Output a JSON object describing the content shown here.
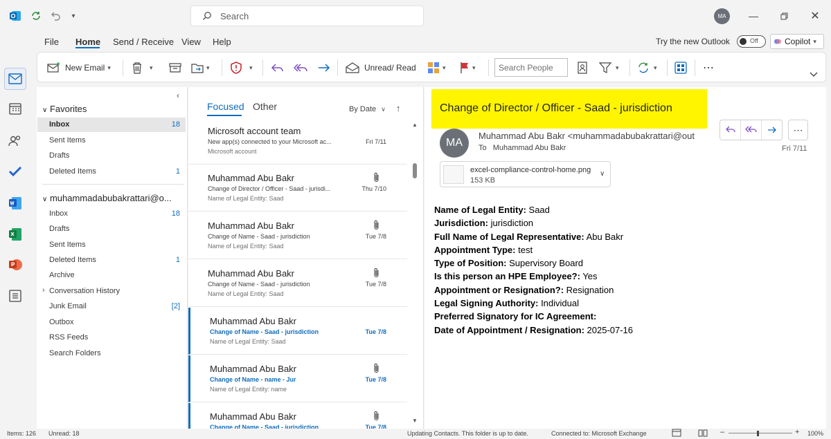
{
  "titlebar": {
    "search_placeholder": "Search",
    "avatar_initials": "MA"
  },
  "menu": {
    "tabs": [
      "File",
      "Home",
      "Send / Receive",
      "View",
      "Help"
    ],
    "try_new_outlook": "Try the new Outlook",
    "toggle_label": "Off",
    "copilot_label": "Copilot"
  },
  "ribbon": {
    "new_email": "New Email",
    "unread_read": "Unread/ Read",
    "search_people_placeholder": "Search People"
  },
  "folders": {
    "favorites_header": "Favorites",
    "favorites": [
      {
        "label": "Inbox",
        "count": "18"
      },
      {
        "label": "Sent Items",
        "count": ""
      },
      {
        "label": "Drafts",
        "count": ""
      },
      {
        "label": "Deleted Items",
        "count": "1"
      }
    ],
    "account_header": "muhammadabubakrattari@o...",
    "account": [
      {
        "label": "Inbox",
        "count": "18"
      },
      {
        "label": "Drafts",
        "count": ""
      },
      {
        "label": "Sent Items",
        "count": ""
      },
      {
        "label": "Deleted Items",
        "count": "1"
      },
      {
        "label": "Archive",
        "count": ""
      },
      {
        "label": "Conversation History",
        "count": ""
      },
      {
        "label": "Junk Email",
        "count": "[2]"
      },
      {
        "label": "Outbox",
        "count": ""
      },
      {
        "label": "RSS Feeds",
        "count": ""
      },
      {
        "label": "Search Folders",
        "count": ""
      }
    ]
  },
  "message_list": {
    "tab_focused": "Focused",
    "tab_other": "Other",
    "sort_label": "By Date",
    "messages": [
      {
        "sender": "Microsoft account team",
        "subject": "New app(s) connected to your Microsoft ac...",
        "preview": "Microsoft account",
        "date": "Fri 7/11",
        "attachment": false,
        "selected": false
      },
      {
        "sender": "Muhammad Abu Bakr",
        "subject": "Change of Director / Officer - Saad - jurisdi...",
        "preview": "Name of Legal Entity: Saad",
        "date": "Thu 7/10",
        "attachment": true,
        "selected": false
      },
      {
        "sender": "Muhammad Abu Bakr",
        "subject": "Change of Name - Saad - jurisdiction",
        "preview": "Name of Legal Entity: Saad",
        "date": "Tue 7/8",
        "attachment": true,
        "selected": false
      },
      {
        "sender": "Muhammad Abu Bakr",
        "subject": "Change of Name - Saad - jurisdiction",
        "preview": "Name of Legal Entity: Saad",
        "date": "Tue 7/8",
        "attachment": true,
        "selected": false
      },
      {
        "sender": "Muhammad Abu Bakr",
        "subject": "Change of Name - Saad - jurisdiction",
        "preview": "Name of Legal Entity: Saad",
        "date": "Tue 7/8",
        "attachment": false,
        "selected": true
      },
      {
        "sender": "Muhammad Abu Bakr",
        "subject": "Change of Name - name - Jur",
        "preview": "Name of Legal Entity: name",
        "date": "Tue 7/8",
        "attachment": true,
        "selected": true
      },
      {
        "sender": "Muhammad Abu Bakr",
        "subject": "Change of Name - Saad - jurisdiction",
        "preview": "",
        "date": "Tue 7/8",
        "attachment": true,
        "selected": true
      }
    ]
  },
  "reading": {
    "subject": "Change of Director / Officer - Saad - jurisdiction",
    "avatar_initials": "MA",
    "sender": "Muhammad Abu Bakr <muhammadabubakrattari@out",
    "to_label": "To",
    "to": "Muhammad Abu Bakr",
    "date": "Fri 7/11",
    "attachment_name": "excel-compliance-control-home.png",
    "attachment_size": "153 KB",
    "fields": [
      {
        "label": "Name of Legal Entity:",
        "value": " Saad"
      },
      {
        "label": "Jurisdiction:",
        "value": " jurisdiction"
      },
      {
        "label": "Full Name of Legal Representative:",
        "value": " Abu Bakr"
      },
      {
        "label": "Appointment Type:",
        "value": " test"
      },
      {
        "label": "Type of Position:",
        "value": " Supervisory Board"
      },
      {
        "label": "Is this person an HPE Employee?:",
        "value": " Yes"
      },
      {
        "label": "Appointment or Resignation?:",
        "value": " Resignation"
      },
      {
        "label": "Legal Signing Authority:",
        "value": " Individual"
      },
      {
        "label": "Preferred Signatory for IC Agreement:",
        "value": ""
      },
      {
        "label": "Date of Appointment / Resignation:",
        "value": " 2025-07-16"
      }
    ]
  },
  "status": {
    "items": "Items: 126",
    "unread": "Unread: 18",
    "updating": "Updating Contacts.  This folder is up to date.",
    "connected": "Connected to: Microsoft Exchange",
    "zoom": "100%"
  },
  "colors": {
    "accent": "#0f6cbd",
    "highlight": "#fff500"
  }
}
